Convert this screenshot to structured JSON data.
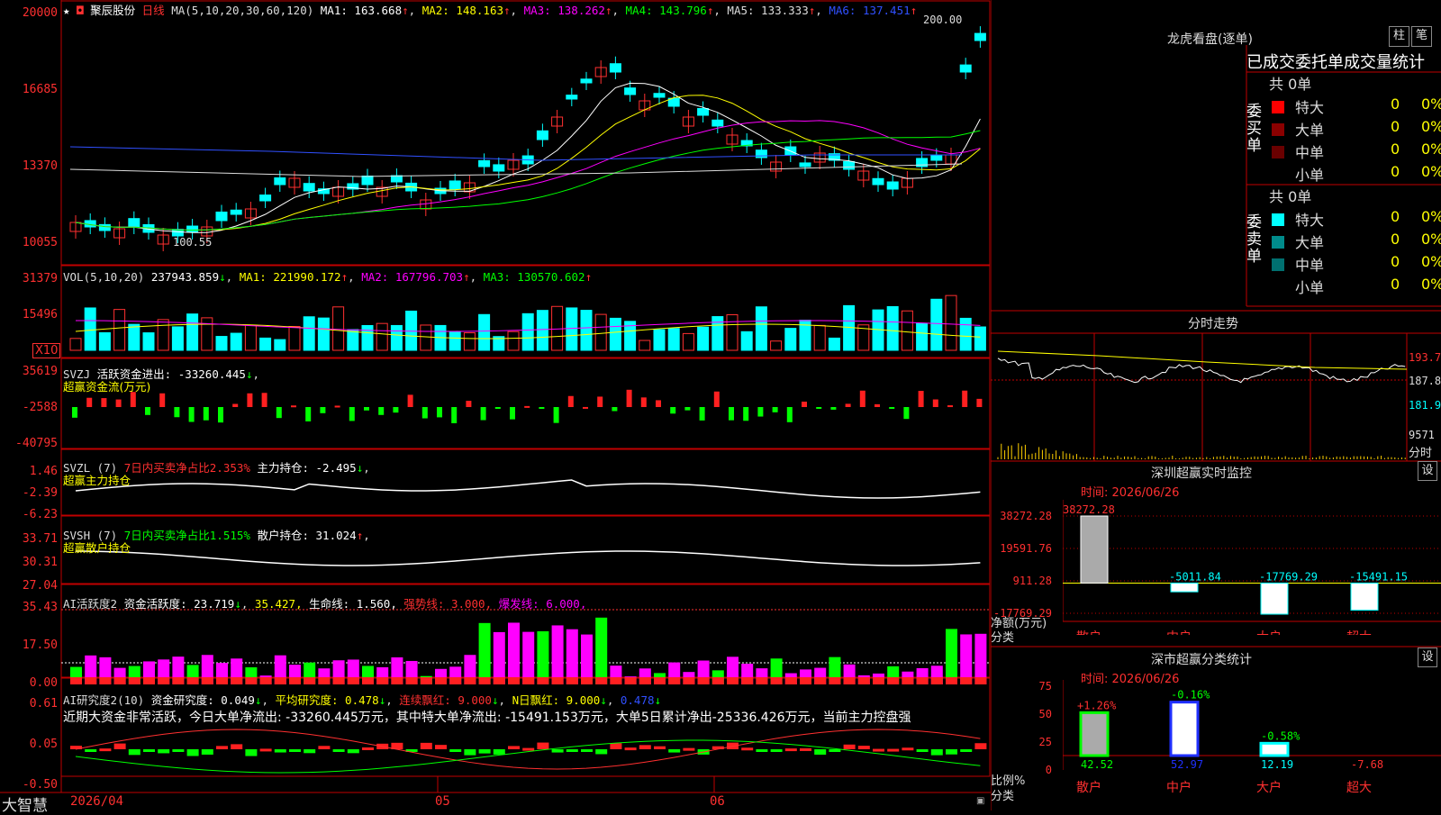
{
  "stock": {
    "name": "聚辰股份",
    "period": "日线",
    "ma_label": "MA(5,10,20,30,60,120)",
    "ma1": "MA1: 163.668",
    "ma2": "MA2: 148.163",
    "ma3": "MA3: 138.262",
    "ma4": "MA4: 143.796",
    "ma5": "MA5: 133.333",
    "ma6": "MA6: 137.451",
    "high_label": "200.00",
    "low_label": "100.55"
  },
  "axes": {
    "price": [
      "20000",
      "16685",
      "13370",
      "10055"
    ],
    "vol": [
      "31379",
      "15496"
    ],
    "vol_multiplier": "X10",
    "svzj": [
      "35619",
      "-2588",
      "-40795"
    ],
    "svzl": [
      "1.46",
      "-2.39",
      "-6.23"
    ],
    "svsh": [
      "33.71",
      "30.31",
      "27.04"
    ],
    "ai1": [
      "35.43",
      "17.50",
      "0.00"
    ],
    "ai2": [
      "0.61",
      "0.05",
      "-0.50"
    ]
  },
  "dates": [
    "2026/04",
    "05",
    "06"
  ],
  "brand": "大智慧",
  "vol_hdr": {
    "label": "VOL(5,10,20)",
    "value": "237943.859",
    "ma1": "MA1: 221990.172",
    "ma2": "MA2: 167796.703",
    "ma3": "MA3: 130570.602"
  },
  "svzj_hdr": {
    "label": "SVZJ",
    "desc": "活跃资金进出: -33260.445",
    "sub": "超赢资金流(万元)"
  },
  "svzl_hdr": {
    "label": "SVZL (7)",
    "desc": "7日内买卖净占比2.353%",
    "desc2": "主力持仓: -2.495",
    "sub": "超赢主力持仓"
  },
  "svsh_hdr": {
    "label": "SVSH (7)",
    "desc": "7日内买卖净占比1.515%",
    "desc2": "散户持仓: 31.024",
    "sub": "超赢散户持仓"
  },
  "ai1_hdr": {
    "label": "AI活跃度2",
    "v1": "资金活跃度: 23.719",
    "v2": "35.427,",
    "v3": "生命线: 1.560,",
    "v4": "强势线: 3.000,",
    "v5": "爆发线: 6.000,"
  },
  "ai2_hdr": {
    "label": "AI研究度2(10)",
    "v1": "资金研究度: 0.049",
    "v2": "平均研究度: 0.478",
    "v3": "连续飘红: 9.000",
    "v4": "N日飘红: 9.000",
    "v5": "0.478",
    "comment": "近期大资金非常活跃，今日大单净流出: -33260.445万元，其中特大单净流出: -15491.153万元，大单5日累计净出-25336.426万元，当前主力控盘强"
  },
  "dragon": {
    "title": "龙虎看盘(逐单)",
    "btn1": "柱",
    "btn2": "笔",
    "subtitle": "已成交委托单成交量统计",
    "buy_label": "委买单",
    "sell_label": "委卖单",
    "buy_total": "共 0单",
    "sell_total": "共 0单",
    "buy_rows": [
      {
        "name": "特大",
        "count": "0",
        "pct": "0%",
        "color": "#ff0000"
      },
      {
        "name": "大单",
        "count": "0",
        "pct": "0%",
        "color": "#8b0000"
      },
      {
        "name": "中单",
        "count": "0",
        "pct": "0%",
        "color": "#6a0000"
      },
      {
        "name": "小单",
        "count": "0",
        "pct": "0%",
        "color": ""
      }
    ],
    "sell_rows": [
      {
        "name": "特大",
        "count": "0",
        "pct": "0%",
        "color": "#00ffff"
      },
      {
        "name": "大单",
        "count": "0",
        "pct": "0%",
        "color": "#008b8b"
      },
      {
        "name": "中单",
        "count": "0",
        "pct": "0%",
        "color": "#007070"
      },
      {
        "name": "小单",
        "count": "0",
        "pct": "0%",
        "color": ""
      }
    ]
  },
  "intraday": {
    "title": "分时走势",
    "p1": "193.7",
    "p2": "187.8",
    "p3": "181.9",
    "vol": "9571",
    "vol_label": "分时"
  },
  "sz_monitor": {
    "title": "深圳超赢实时监控",
    "btn": "设",
    "time": "时间: 2026/06/26",
    "y": [
      "38272.28",
      "19591.76",
      "911.28",
      "-17769.29"
    ],
    "ylabel1": "净额(万元)",
    "ylabel2": "分类",
    "cats": [
      "散户",
      "中户",
      "大户",
      "超大"
    ],
    "chart_data": {
      "type": "bar",
      "categories": [
        "散户",
        "中户",
        "大户",
        "超大"
      ],
      "values": [
        38272.28,
        -5011.84,
        -17769.29,
        -15491.15
      ],
      "value_labels": [
        "38272.28",
        "-5011.84",
        "-17769.29",
        "-15491.15"
      ],
      "ylim": [
        -17769.29,
        38272.28
      ]
    }
  },
  "sz_class": {
    "title": "深市超赢分类统计",
    "btn": "设",
    "time": "时间: 2026/06/26",
    "y": [
      "75",
      "50",
      "25",
      "0"
    ],
    "ylabel1": "比例%",
    "ylabel2": "分类",
    "cats": [
      "散户",
      "中户",
      "大户",
      "超大"
    ],
    "chart_data": {
      "type": "bar",
      "categories": [
        "散户",
        "中户",
        "大户",
        "超大"
      ],
      "values": [
        42.52,
        52.97,
        12.19,
        -7.68
      ],
      "value_labels": [
        "42.52",
        "52.97",
        "12.19",
        "-7.68"
      ],
      "changes": [
        "+1.26%",
        "-0.16%",
        "-0.58%",
        ""
      ],
      "colors": [
        "#00ff00",
        "#2030ff",
        "#00ffff",
        "#ff3030"
      ],
      "ylim": [
        0,
        75
      ]
    }
  }
}
